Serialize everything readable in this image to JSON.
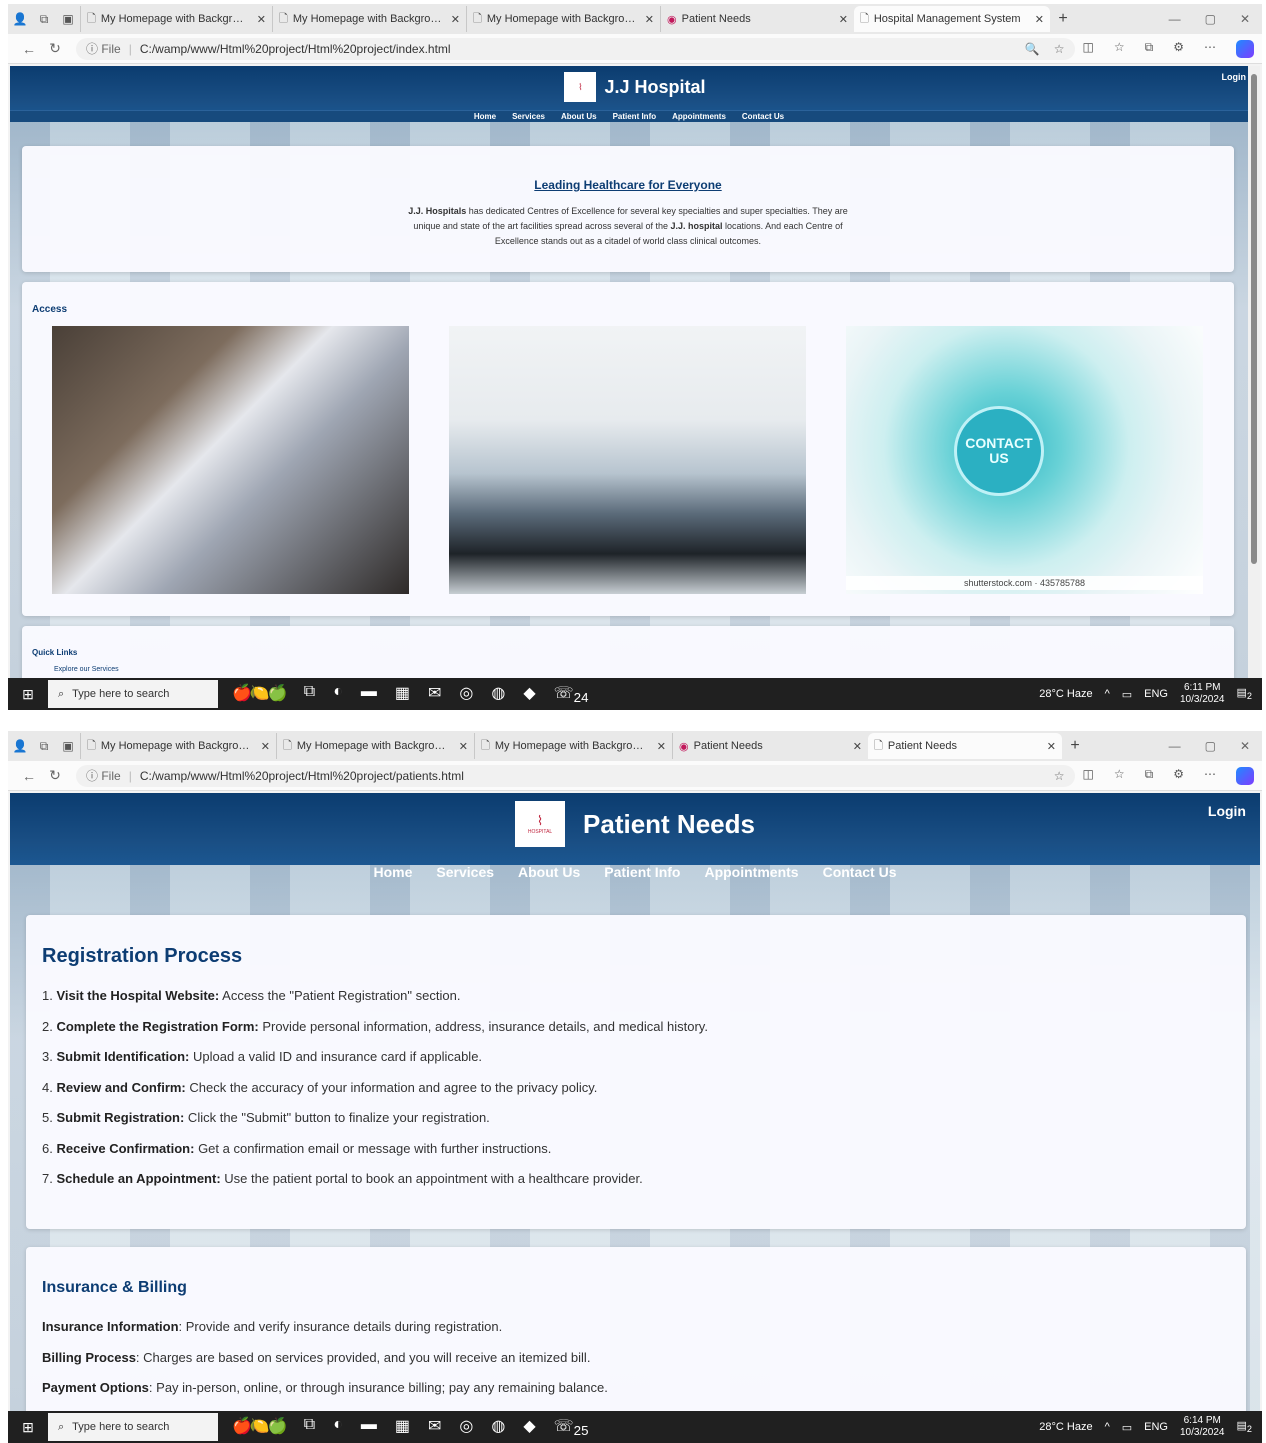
{
  "tabs_common": [
    "My Homepage with Background",
    "My Homepage with Background",
    "My Homepage with Background",
    "Patient Needs"
  ],
  "shot1": {
    "active_tab": "Hospital Management System",
    "url": "C:/wamp/www/Html%20project/Html%20project/index.html",
    "file_label": "File",
    "site_title": "J.J Hospital",
    "login": "Login",
    "nav": [
      "Home",
      "Services",
      "About Us",
      "Patient Info",
      "Appointments",
      "Contact Us"
    ],
    "hero_title": "Leading Healthcare for Everyone",
    "hero_p1_bold": "J.J. Hospitals",
    "hero_p1_rest": " has dedicated Centres of Excellence for several key specialties and super specialties. They are unique and state of the art facilities spread across several of the ",
    "hero_p1_bold2": "J.J. hospital",
    "hero_p1_end": " locations. And each Centre of Excellence stands out as a citadel of world class clinical outcomes.",
    "access_title": "Access",
    "contact_us_text": "CONTACT US",
    "watermark": "shutterstock.com · 435785788",
    "quick_links_title": "Quick Links",
    "quick_links_sub": "Explore our Services",
    "taskbar": {
      "search": "Type here to search",
      "weather": "28°C Haze",
      "lang": "ENG",
      "time": "6:11 PM",
      "date": "10/3/2024",
      "whatsapp_badge": "24",
      "notif_badge": "2"
    }
  },
  "shot2": {
    "active_tab": "Patient Needs",
    "url": "C:/wamp/www/Html%20project/Html%20project/patients.html",
    "file_label": "File",
    "site_title": "Patient Needs",
    "login": "Login",
    "nav": [
      "Home",
      "Services",
      "About Us",
      "Patient Info",
      "Appointments",
      "Contact Us"
    ],
    "registration": {
      "title": "Registration Process",
      "steps": [
        {
          "n": "1.",
          "bold": "Visit the Hospital Website:",
          "text": " Access the \"Patient Registration\" section."
        },
        {
          "n": "2.",
          "bold": "Complete the Registration Form:",
          "text": " Provide personal information, address, insurance details, and medical history."
        },
        {
          "n": "3.",
          "bold": "Submit Identification:",
          "text": " Upload a valid ID and insurance card if applicable."
        },
        {
          "n": "4.",
          "bold": "Review and Confirm:",
          "text": " Check the accuracy of your information and agree to the privacy policy."
        },
        {
          "n": "5.",
          "bold": "Submit Registration:",
          "text": " Click the \"Submit\" button to finalize your registration."
        },
        {
          "n": "6.",
          "bold": "Receive Confirmation:",
          "text": " Get a confirmation email or message with further instructions."
        },
        {
          "n": "7.",
          "bold": "Schedule an Appointment:",
          "text": " Use the patient portal to book an appointment with a healthcare provider."
        }
      ]
    },
    "insurance": {
      "title": "Insurance & Billing",
      "items": [
        {
          "bold": "Insurance Information",
          "text": ": Provide and verify insurance details during registration."
        },
        {
          "bold": "Billing Process",
          "text": ": Charges are based on services provided, and you will receive an itemized bill."
        },
        {
          "bold": "Payment Options",
          "text": ": Pay in-person, online, or through insurance billing; pay any remaining balance."
        }
      ]
    },
    "taskbar": {
      "search": "Type here to search",
      "weather": "28°C Haze",
      "lang": "ENG",
      "time": "6:14 PM",
      "date": "10/3/2024",
      "whatsapp_badge": "25",
      "notif_badge": "2"
    }
  }
}
